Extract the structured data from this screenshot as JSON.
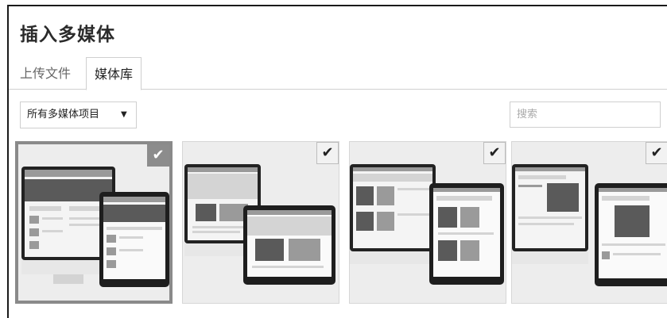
{
  "dialog": {
    "title": "插入多媒体"
  },
  "tabs": [
    {
      "label": "上传文件",
      "active": false
    },
    {
      "label": "媒体库",
      "active": true
    }
  ],
  "filter": {
    "selected": "所有多媒体项目",
    "arrow": "▼"
  },
  "search": {
    "placeholder": "搜索"
  },
  "media_items": [
    {
      "selected": true,
      "check": "✔"
    },
    {
      "selected": false,
      "check": "✔"
    },
    {
      "selected": false,
      "check": "✔"
    },
    {
      "selected": false,
      "check": "✔"
    }
  ],
  "colors": {
    "selected_border": "#8a8a8a",
    "tile_bg": "#ededed",
    "frame_border": "#1a1a1a"
  }
}
